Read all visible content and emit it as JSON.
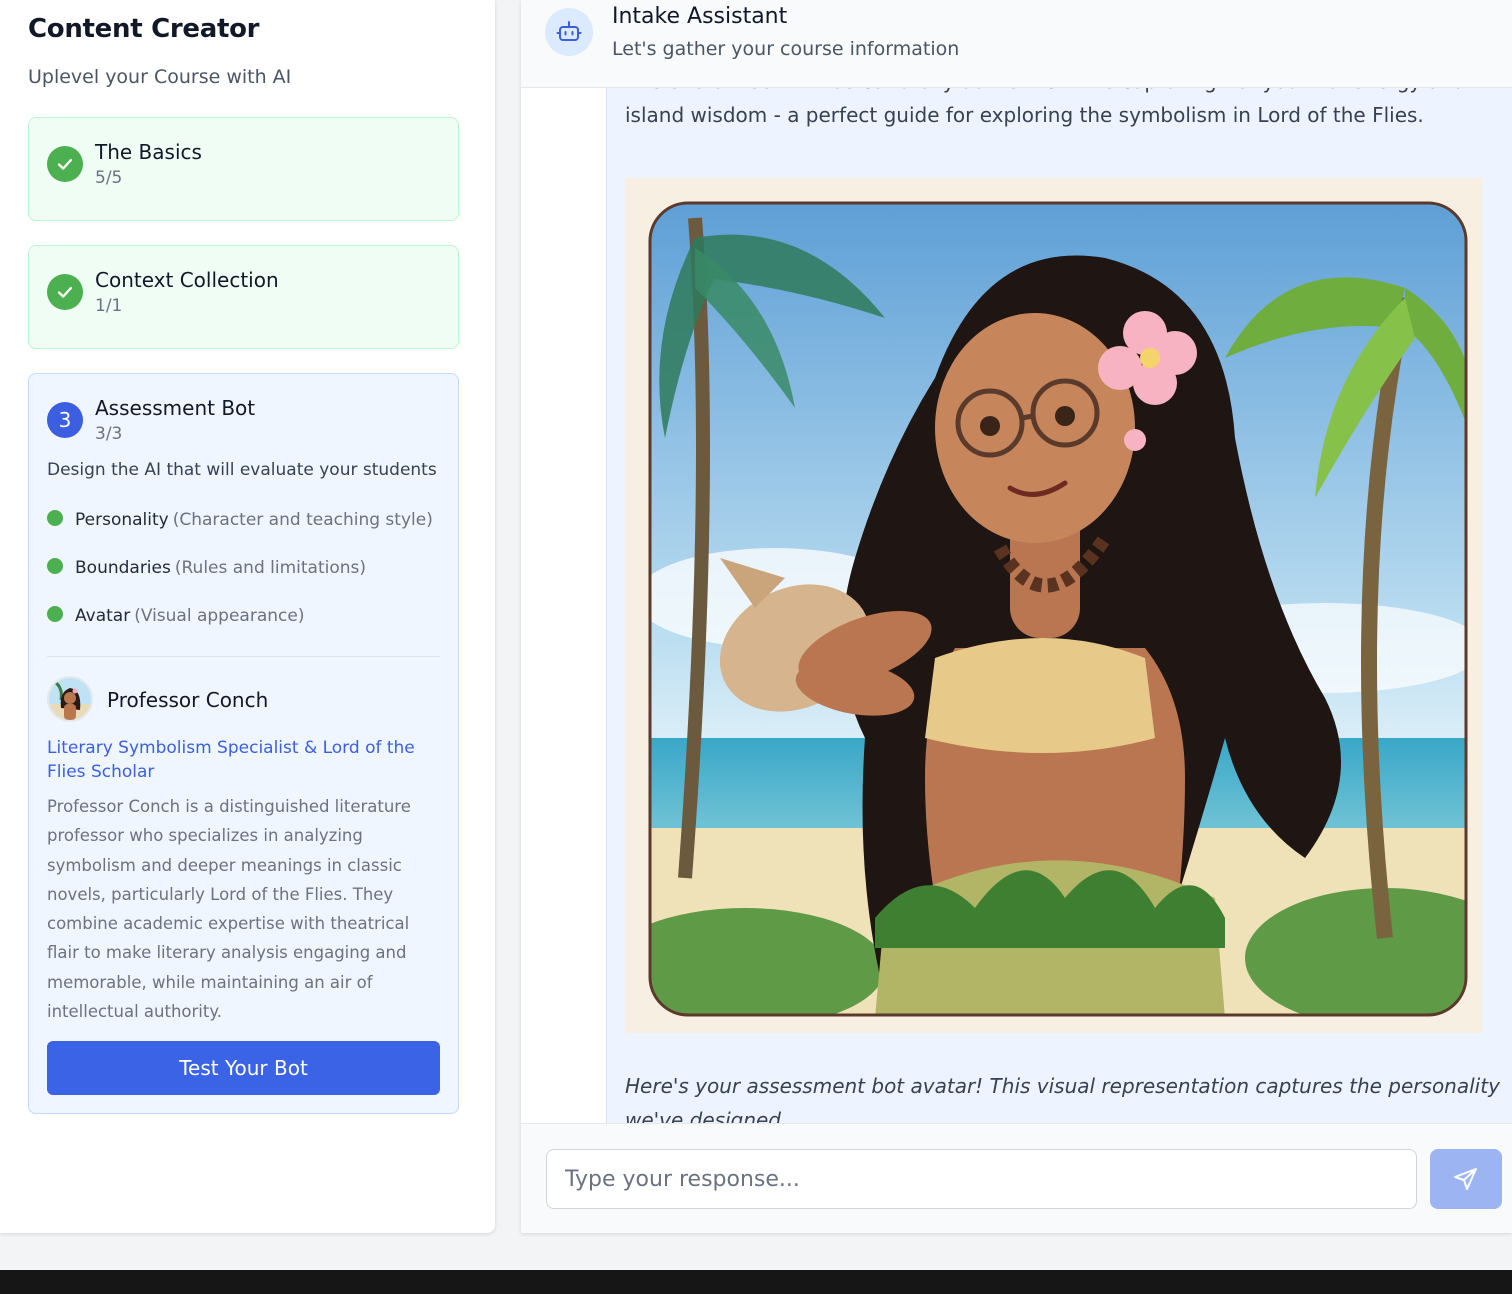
{
  "sidebar": {
    "title": "Content Creator",
    "subtitle": "Uplevel your Course with AI",
    "steps": [
      {
        "title": "The Basics",
        "count": "5/5",
        "status": "complete"
      },
      {
        "title": "Context Collection",
        "count": "1/1",
        "status": "complete"
      },
      {
        "number": "3",
        "title": "Assessment Bot",
        "count": "3/3",
        "status": "active",
        "description": "Design the AI that will evaluate your students",
        "requirements": [
          {
            "label": "Personality",
            "hint": "(Character and teaching style)"
          },
          {
            "label": "Boundaries",
            "hint": "(Rules and limitations)"
          },
          {
            "label": "Avatar",
            "hint": "(Visual appearance)"
          }
        ]
      }
    ],
    "bot": {
      "name": "Professor Conch",
      "role": "Literary Symbolism Specialist & Lord of the Flies Scholar",
      "bio": "Professor Conch is a distinguished literature professor who specializes in analyzing symbolism and deeper meanings in classic novels, particularly Lord of the Flies. They combine academic expertise with theatrical flair to make literary analysis engaging and memorable, while maintaining an air of intellectual authority.",
      "test_button": "Test Your Bot"
    }
  },
  "chat": {
    "title": "Intake Assistant",
    "subtitle": "Let's gather your course information",
    "messages": {
      "partial_top": "The overall look will be culturally authentic while capturing her youthful energy and island wisdom - a perfect guide for exploring the symbolism in Lord of the Flies.",
      "image_icon": "avatar-illustration",
      "caption": "Here's your assessment bot avatar! This visual representation captures the personality we've designed."
    },
    "input_placeholder": "Type your response...",
    "send_icon": "send-icon"
  },
  "colors": {
    "primary": "#3b63e5",
    "success": "#4caf50",
    "link": "#3b5fe0",
    "done_bg": "#f0fdf4",
    "active_bg": "#eff6ff"
  }
}
